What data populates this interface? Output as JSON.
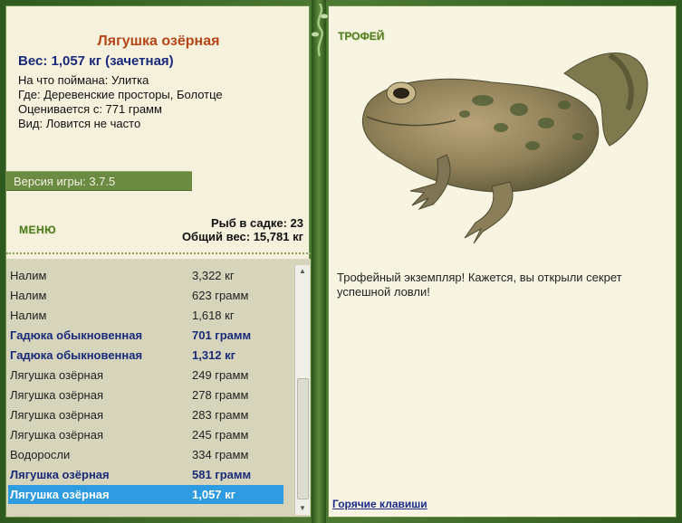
{
  "catch": {
    "title": "Лягушка озёрная",
    "weight_line": "Вес: 1,057 кг (зачетная)",
    "bait": "На что поймана: Улитка",
    "location": "Где: Деревенские просторы, Болотце",
    "valued_from": "Оценивается с: 771 грамм",
    "kind": "Вид: Ловится не часто"
  },
  "version": "Версия игры: 3.7.5",
  "menu_label": "МЕНЮ",
  "stats": {
    "fish_count": "Рыб в садке: 23",
    "total_weight": "Общий вес: 15,781 кг"
  },
  "catch_list": [
    {
      "name": "Налим",
      "weight": "3,322 кг",
      "style": "normal"
    },
    {
      "name": "Налим",
      "weight": "623 грамм",
      "style": "normal"
    },
    {
      "name": "Налим",
      "weight": "1,618 кг",
      "style": "normal"
    },
    {
      "name": "Гадюка обыкновенная",
      "weight": "701 грамм",
      "style": "highlight"
    },
    {
      "name": "Гадюка обыкновенная",
      "weight": "1,312 кг",
      "style": "highlight"
    },
    {
      "name": "Лягушка озёрная",
      "weight": "249 грамм",
      "style": "normal"
    },
    {
      "name": "Лягушка озёрная",
      "weight": "278 грамм",
      "style": "normal"
    },
    {
      "name": "Лягушка озёрная",
      "weight": "283 грамм",
      "style": "normal"
    },
    {
      "name": "Лягушка озёрная",
      "weight": "245 грамм",
      "style": "normal"
    },
    {
      "name": "Водоросли",
      "weight": "334 грамм",
      "style": "normal"
    },
    {
      "name": "Лягушка озёрная",
      "weight": "581 грамм",
      "style": "highlight"
    },
    {
      "name": "Лягушка озёрная",
      "weight": "1,057 кг",
      "style": "selected"
    }
  ],
  "trophy": {
    "label": "ТРОФЕЙ",
    "text": "Трофейный экземпляр! Кажется, вы открыли секрет успешной ловли!"
  },
  "hotkeys_link": "Горячие клавиши",
  "colors": {
    "title": "#b5461a",
    "highlight": "#1a2a7a",
    "selected_bg": "#2f9be0",
    "frame_green": "#3f6b2a"
  }
}
